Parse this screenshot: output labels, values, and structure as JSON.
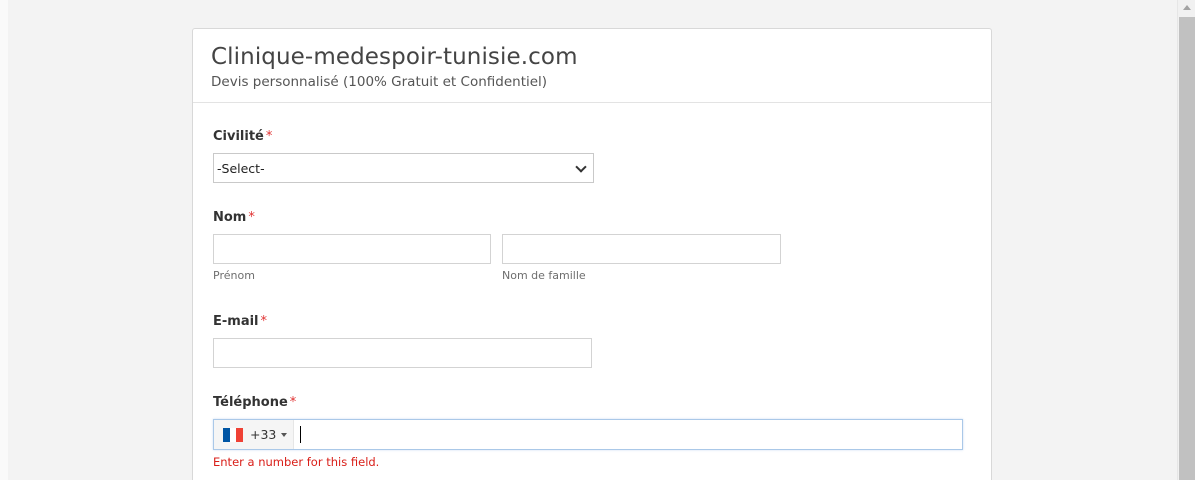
{
  "form": {
    "title": "Clinique-medespoir-tunisie.com",
    "subtitle": "Devis personnalisé (100% Gratuit et Confidentiel)"
  },
  "civilite": {
    "label": "Civilité",
    "required_mark": "*",
    "selected_value": "-Select-"
  },
  "nom": {
    "label": "Nom",
    "required_mark": "*",
    "first_name_sublabel": "Prénom",
    "last_name_sublabel": "Nom de famille",
    "first_name_value": "",
    "last_name_value": ""
  },
  "email": {
    "label": "E-mail",
    "required_mark": "*",
    "value": ""
  },
  "telephone": {
    "label": "Téléphone",
    "required_mark": "*",
    "country_flag": "france-flag-icon",
    "dial_code": "+33",
    "value": "",
    "error": "Enter a number for this field."
  },
  "colors": {
    "required": "#e03131",
    "error": "#d91e18",
    "focus_border": "#aac8e8",
    "flag_blue": "#0055a4",
    "flag_white": "#ffffff",
    "flag_red": "#ef4135"
  }
}
